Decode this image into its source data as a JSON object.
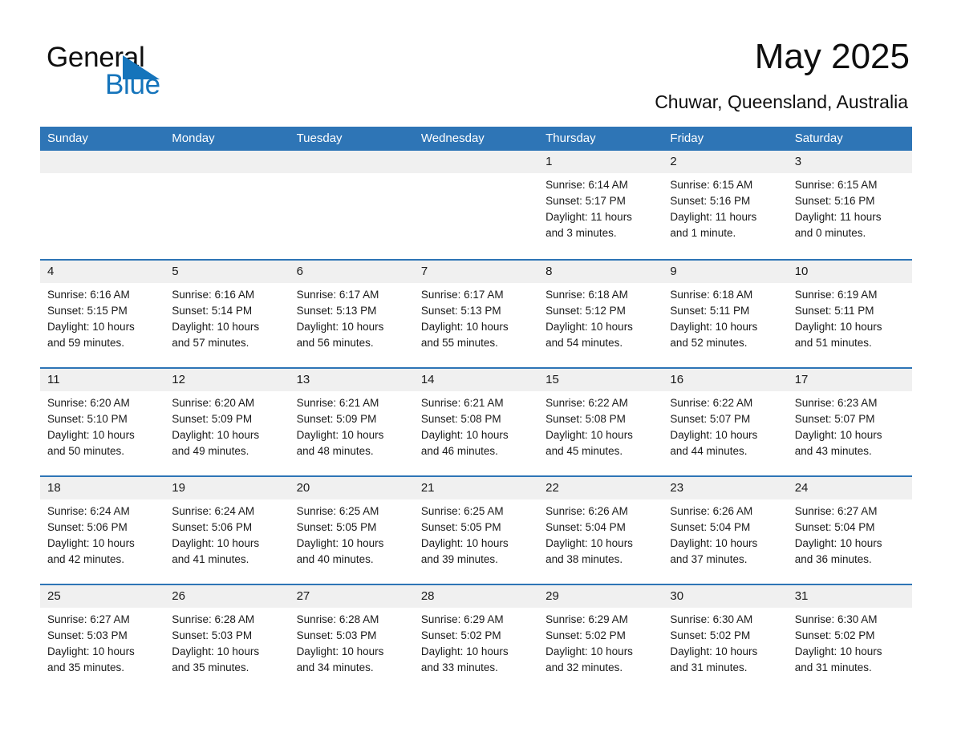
{
  "brand": {
    "line1": "General",
    "line2": "Blue",
    "triangle_color": "#1574bb",
    "text_color": "#0f0f0f"
  },
  "header": {
    "title": "May 2025",
    "subtitle": "Chuwar, Queensland, Australia"
  },
  "theme": {
    "header_blue": "#2e75b6",
    "day_band_gray": "#f0f0f0",
    "cell_white": "#ffffff",
    "text": "#1a1a1a"
  },
  "weekdays": [
    "Sunday",
    "Monday",
    "Tuesday",
    "Wednesday",
    "Thursday",
    "Friday",
    "Saturday"
  ],
  "weeks": [
    [
      {
        "day": "",
        "empty": true,
        "l1": "",
        "l2": "",
        "l3": "",
        "l4": ""
      },
      {
        "day": "",
        "empty": true,
        "l1": "",
        "l2": "",
        "l3": "",
        "l4": ""
      },
      {
        "day": "",
        "empty": true,
        "l1": "",
        "l2": "",
        "l3": "",
        "l4": ""
      },
      {
        "day": "",
        "empty": true,
        "l1": "",
        "l2": "",
        "l3": "",
        "l4": ""
      },
      {
        "day": "1",
        "l1": "Sunrise: 6:14 AM",
        "l2": "Sunset: 5:17 PM",
        "l3": "Daylight: 11 hours",
        "l4": "and 3 minutes."
      },
      {
        "day": "2",
        "l1": "Sunrise: 6:15 AM",
        "l2": "Sunset: 5:16 PM",
        "l3": "Daylight: 11 hours",
        "l4": "and 1 minute."
      },
      {
        "day": "3",
        "l1": "Sunrise: 6:15 AM",
        "l2": "Sunset: 5:16 PM",
        "l3": "Daylight: 11 hours",
        "l4": "and 0 minutes."
      }
    ],
    [
      {
        "day": "4",
        "l1": "Sunrise: 6:16 AM",
        "l2": "Sunset: 5:15 PM",
        "l3": "Daylight: 10 hours",
        "l4": "and 59 minutes."
      },
      {
        "day": "5",
        "l1": "Sunrise: 6:16 AM",
        "l2": "Sunset: 5:14 PM",
        "l3": "Daylight: 10 hours",
        "l4": "and 57 minutes."
      },
      {
        "day": "6",
        "l1": "Sunrise: 6:17 AM",
        "l2": "Sunset: 5:13 PM",
        "l3": "Daylight: 10 hours",
        "l4": "and 56 minutes."
      },
      {
        "day": "7",
        "l1": "Sunrise: 6:17 AM",
        "l2": "Sunset: 5:13 PM",
        "l3": "Daylight: 10 hours",
        "l4": "and 55 minutes."
      },
      {
        "day": "8",
        "l1": "Sunrise: 6:18 AM",
        "l2": "Sunset: 5:12 PM",
        "l3": "Daylight: 10 hours",
        "l4": "and 54 minutes."
      },
      {
        "day": "9",
        "l1": "Sunrise: 6:18 AM",
        "l2": "Sunset: 5:11 PM",
        "l3": "Daylight: 10 hours",
        "l4": "and 52 minutes."
      },
      {
        "day": "10",
        "l1": "Sunrise: 6:19 AM",
        "l2": "Sunset: 5:11 PM",
        "l3": "Daylight: 10 hours",
        "l4": "and 51 minutes."
      }
    ],
    [
      {
        "day": "11",
        "l1": "Sunrise: 6:20 AM",
        "l2": "Sunset: 5:10 PM",
        "l3": "Daylight: 10 hours",
        "l4": "and 50 minutes."
      },
      {
        "day": "12",
        "l1": "Sunrise: 6:20 AM",
        "l2": "Sunset: 5:09 PM",
        "l3": "Daylight: 10 hours",
        "l4": "and 49 minutes."
      },
      {
        "day": "13",
        "l1": "Sunrise: 6:21 AM",
        "l2": "Sunset: 5:09 PM",
        "l3": "Daylight: 10 hours",
        "l4": "and 48 minutes."
      },
      {
        "day": "14",
        "l1": "Sunrise: 6:21 AM",
        "l2": "Sunset: 5:08 PM",
        "l3": "Daylight: 10 hours",
        "l4": "and 46 minutes."
      },
      {
        "day": "15",
        "l1": "Sunrise: 6:22 AM",
        "l2": "Sunset: 5:08 PM",
        "l3": "Daylight: 10 hours",
        "l4": "and 45 minutes."
      },
      {
        "day": "16",
        "l1": "Sunrise: 6:22 AM",
        "l2": "Sunset: 5:07 PM",
        "l3": "Daylight: 10 hours",
        "l4": "and 44 minutes."
      },
      {
        "day": "17",
        "l1": "Sunrise: 6:23 AM",
        "l2": "Sunset: 5:07 PM",
        "l3": "Daylight: 10 hours",
        "l4": "and 43 minutes."
      }
    ],
    [
      {
        "day": "18",
        "l1": "Sunrise: 6:24 AM",
        "l2": "Sunset: 5:06 PM",
        "l3": "Daylight: 10 hours",
        "l4": "and 42 minutes."
      },
      {
        "day": "19",
        "l1": "Sunrise: 6:24 AM",
        "l2": "Sunset: 5:06 PM",
        "l3": "Daylight: 10 hours",
        "l4": "and 41 minutes."
      },
      {
        "day": "20",
        "l1": "Sunrise: 6:25 AM",
        "l2": "Sunset: 5:05 PM",
        "l3": "Daylight: 10 hours",
        "l4": "and 40 minutes."
      },
      {
        "day": "21",
        "l1": "Sunrise: 6:25 AM",
        "l2": "Sunset: 5:05 PM",
        "l3": "Daylight: 10 hours",
        "l4": "and 39 minutes."
      },
      {
        "day": "22",
        "l1": "Sunrise: 6:26 AM",
        "l2": "Sunset: 5:04 PM",
        "l3": "Daylight: 10 hours",
        "l4": "and 38 minutes."
      },
      {
        "day": "23",
        "l1": "Sunrise: 6:26 AM",
        "l2": "Sunset: 5:04 PM",
        "l3": "Daylight: 10 hours",
        "l4": "and 37 minutes."
      },
      {
        "day": "24",
        "l1": "Sunrise: 6:27 AM",
        "l2": "Sunset: 5:04 PM",
        "l3": "Daylight: 10 hours",
        "l4": "and 36 minutes."
      }
    ],
    [
      {
        "day": "25",
        "l1": "Sunrise: 6:27 AM",
        "l2": "Sunset: 5:03 PM",
        "l3": "Daylight: 10 hours",
        "l4": "and 35 minutes."
      },
      {
        "day": "26",
        "l1": "Sunrise: 6:28 AM",
        "l2": "Sunset: 5:03 PM",
        "l3": "Daylight: 10 hours",
        "l4": "and 35 minutes."
      },
      {
        "day": "27",
        "l1": "Sunrise: 6:28 AM",
        "l2": "Sunset: 5:03 PM",
        "l3": "Daylight: 10 hours",
        "l4": "and 34 minutes."
      },
      {
        "day": "28",
        "l1": "Sunrise: 6:29 AM",
        "l2": "Sunset: 5:02 PM",
        "l3": "Daylight: 10 hours",
        "l4": "and 33 minutes."
      },
      {
        "day": "29",
        "l1": "Sunrise: 6:29 AM",
        "l2": "Sunset: 5:02 PM",
        "l3": "Daylight: 10 hours",
        "l4": "and 32 minutes."
      },
      {
        "day": "30",
        "l1": "Sunrise: 6:30 AM",
        "l2": "Sunset: 5:02 PM",
        "l3": "Daylight: 10 hours",
        "l4": "and 31 minutes."
      },
      {
        "day": "31",
        "l1": "Sunrise: 6:30 AM",
        "l2": "Sunset: 5:02 PM",
        "l3": "Daylight: 10 hours",
        "l4": "and 31 minutes."
      }
    ]
  ]
}
